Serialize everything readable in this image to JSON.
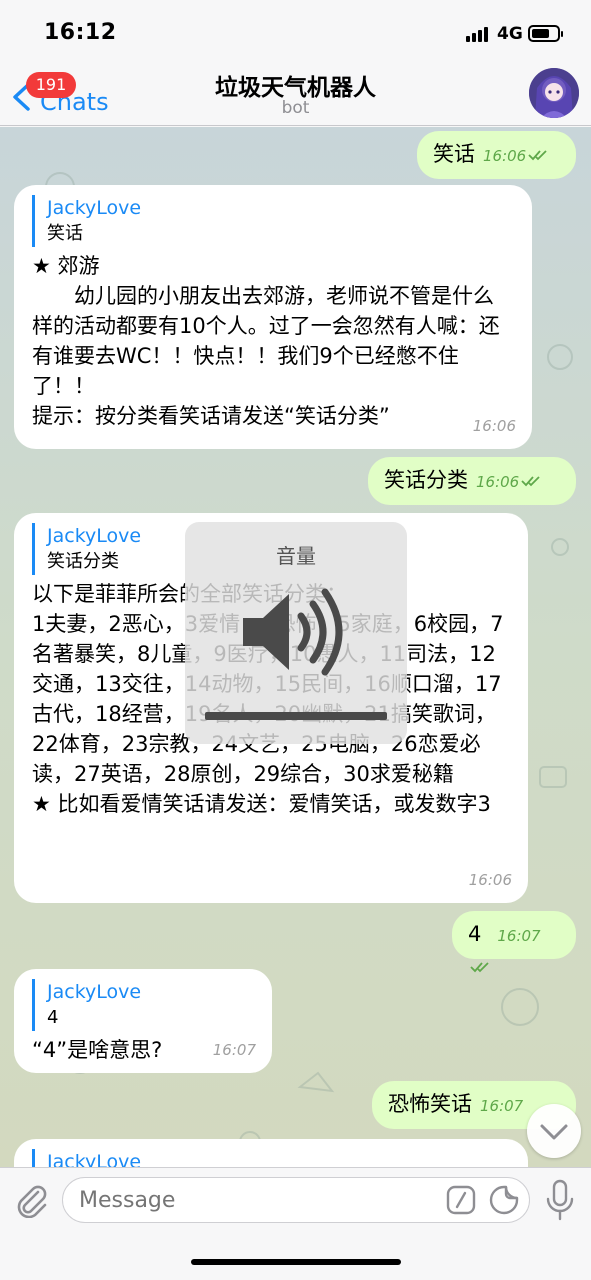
{
  "status_bar": {
    "time": "16:12",
    "network": "4G"
  },
  "nav": {
    "back_label": "Chats",
    "unread_badge": "191",
    "title": "垃圾天气机器人",
    "subtitle": "bot"
  },
  "messages": [
    {
      "id": "m1",
      "direction": "out",
      "text": "笑话",
      "time": "16:06"
    },
    {
      "id": "m2",
      "direction": "in",
      "reply_to": {
        "name": "JackyLove",
        "text": "笑话"
      },
      "text": "★ 郊游\n　　幼儿园的小朋友出去郊游，老师说不管是什么样的活动都要有10个人。过了一会忽然有人喊：还有谁要去WC！！快点！！我们9个已经憋不住了！！\n提示：按分类看笑话请发送“笑话分类”",
      "time": "16:06"
    },
    {
      "id": "m3",
      "direction": "out",
      "text": "笑话分类",
      "time": "16:06"
    },
    {
      "id": "m4",
      "direction": "in",
      "reply_to": {
        "name": "JackyLove",
        "text": "笑话分类"
      },
      "text": "以下是菲菲所会的全部笑话分类：\n1夫妻，2恶心，3爱情，4恐怖，5家庭，6校园，7名著暴笑，8儿童，9医疗，10愚人，11司法，12交通，13交往，14动物，15民间，16顺口溜，17古代，18经营，19名人，20幽默，21搞笑歌词，22体育，23宗教，24文艺，25电脑，26恋爱必读，27英语，28原创，29综合，30求爱秘籍\n★ 比如看爱情笑话请发送：爱情笑话，或发数字3",
      "time": "16:06"
    },
    {
      "id": "m5",
      "direction": "out",
      "text": "4",
      "time": "16:07"
    },
    {
      "id": "m6",
      "direction": "in",
      "reply_to": {
        "name": "JackyLove",
        "text": "4"
      },
      "text": "“4”是啥意思?",
      "time": "16:07"
    },
    {
      "id": "m7",
      "direction": "out",
      "text": "恐怖笑话",
      "time": "16:07"
    },
    {
      "id": "m8",
      "direction": "in",
      "reply_to": {
        "name": "JackyLove",
        "text": ""
      },
      "text": "",
      "time": ""
    }
  ],
  "volume_hud": {
    "title": "音量",
    "level": 1.0
  },
  "input": {
    "placeholder": "Message"
  },
  "icons": {
    "back": "chevron-left-icon",
    "attach": "paperclip-icon",
    "command": "slash-command-icon",
    "sticker": "sticker-icon",
    "mic": "microphone-icon",
    "scroll": "chevron-down-icon",
    "read": "double-check-icon",
    "volume": "speaker-icon"
  },
  "colors": {
    "accent": "#1a8af5",
    "outgoing_bubble": "#e1fec6",
    "incoming_bubble": "#ffffff",
    "badge": "#f23a3a",
    "check": "#5fa84a"
  }
}
